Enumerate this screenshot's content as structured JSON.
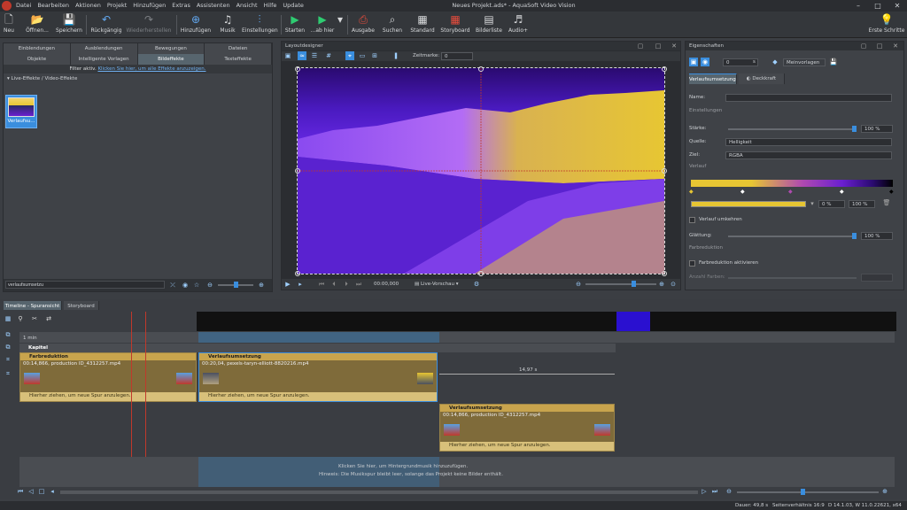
{
  "window": {
    "title": "Neues Projekt.ads* - AquaSoft Video Vision"
  },
  "menu": [
    "Datei",
    "Bearbeiten",
    "Aktionen",
    "Projekt",
    "Hinzufügen",
    "Extras",
    "Assistenten",
    "Ansicht",
    "Hilfe",
    "Update"
  ],
  "toolbar": {
    "new": "Neu",
    "open": "Öffnen...",
    "save": "Speichern",
    "undo": "Rückgängig",
    "redo": "Wiederherstellen",
    "add": "Hinzufügen",
    "music": "Musik",
    "settings": "Einstellungen",
    "start": "Starten",
    "from_here": "...ab hier",
    "output": "Ausgabe",
    "search": "Suchen",
    "standard": "Standard",
    "storyboard": "Storyboard",
    "image_list": "Bilderliste",
    "audio": "Audio+",
    "first_steps": "Erste Schritte"
  },
  "left_panel": {
    "tabs_row1": [
      "Einblendungen",
      "Ausblendungen",
      "Bewegungen",
      "Dateien"
    ],
    "tabs_row2": [
      "Objekte",
      "Intelligente Vorlagen",
      "Bildeffekte",
      "Texteffekte"
    ],
    "filter_text": "Filter aktiv.",
    "filter_link": "Klicken Sie hier, um alle Effekte anzuzeigen.",
    "section": "Live-Effekte / Video-Effekte",
    "effect_label": "Verlaufsu...",
    "search_value": "verlaufsumsetzu"
  },
  "layout_designer": {
    "title": "Layoutdesigner",
    "marker_label": "Zeitmarke:",
    "marker_value": "0",
    "time": "00:00,000",
    "preview_mode": "Live-Vorschau"
  },
  "properties": {
    "title": "Eigenschaften",
    "number_value": "0",
    "spin_unit": "s",
    "template_label": "Meinvorlagen",
    "tabs": [
      "Verlaufsumsetzung",
      "Deckkraft"
    ],
    "name_label": "Name:",
    "section_settings": "Einstellungen",
    "strength_label": "Stärke:",
    "strength_value": "100 %",
    "source_label": "Quelle:",
    "source_value": "Helligkeit",
    "target_label": "Ziel:",
    "target_value": "RGBA",
    "section_gradient": "Verlauf",
    "gradient_val1": "0 %",
    "gradient_val2": "100 %",
    "invert_label": "Verlauf umkehren",
    "smooth_label": "Glättung:",
    "smooth_value": "100 %",
    "section_color_reduction": "Farbreduktion",
    "color_reduction_label": "Farbreduktion aktivieren",
    "num_colors_label": "Anzahl Farben:"
  },
  "timeline": {
    "tabs": [
      "Timeline - Spuransicht",
      "Storyboard"
    ],
    "ruler_label": "1 min",
    "chapter": "Kapitel",
    "clip1": {
      "title": "Farbreduktion",
      "info": "00:14,866, production ID_4312257.mp4",
      "drop": "Hierher ziehen, um neue Spur anzulegen."
    },
    "clip2": {
      "title": "Verlaufsumsetzung",
      "info": "00:20,04, pexels-taryn-elliott-8820216.mp4",
      "drop": "Hierher ziehen, um neue Spur anzulegen."
    },
    "gap": "14,97 s",
    "clip3": {
      "title": "Verlaufsumsetzung",
      "info": "00:14,866, production ID_4312257.mp4",
      "drop": "Hierher ziehen, um neue Spur anzulegen."
    },
    "music_hint1": "Klicken Sie hier, um Hintergrundmusik hinzuzufügen.",
    "music_hint2": "Hinweis: Die Musikspur bleibt leer, solange das Projekt keine Bilder enthält."
  },
  "statusbar": {
    "duration": "Dauer: 49,8 s",
    "ratio": "Seitenverhältnis 16:9",
    "version": "D 14.1.03, W 11.0.22621, x64"
  },
  "colors": {
    "accent": "#3a8ede",
    "clip": "#c8a44d",
    "purple": "#6a1fd0",
    "yellow": "#e7c633"
  }
}
